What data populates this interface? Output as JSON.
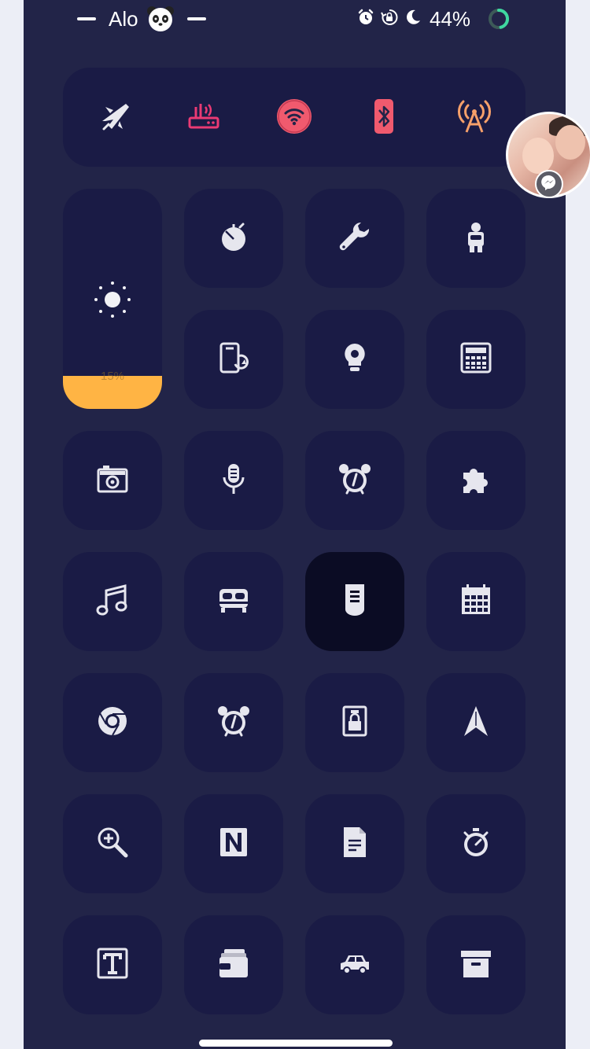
{
  "status_bar": {
    "carrier": "Alo",
    "emoji_icon": "panda-face-icon",
    "icons": [
      "alarm-clock-icon",
      "rotation-lock-icon",
      "moon-icon"
    ],
    "battery_percent": "44%",
    "battery_ring_icon": "battery-ring-icon"
  },
  "connectivity": [
    {
      "name": "airplane-mode",
      "icon": "airplane-icon",
      "color": "#e8e8ee"
    },
    {
      "name": "mobile-hotspot",
      "icon": "router-icon",
      "color": "#ea3a74"
    },
    {
      "name": "wifi",
      "icon": "wifi-icon",
      "color": "#f05a6e"
    },
    {
      "name": "bluetooth",
      "icon": "bluetooth-icon",
      "color": "#f05a6e"
    },
    {
      "name": "cellular-data",
      "icon": "antenna-icon",
      "color": "#f6a06a"
    }
  ],
  "brightness": {
    "icon": "sun-icon",
    "value_label": "15%",
    "level": 0.15,
    "fill_color": "#ffb444"
  },
  "tiles": [
    {
      "name": "timer",
      "icon": "timer-icon"
    },
    {
      "name": "tools",
      "icon": "wrench-icon"
    },
    {
      "name": "accessibility",
      "icon": "astronaut-icon"
    },
    {
      "name": "screen-rotate",
      "icon": "phone-rotate-icon"
    },
    {
      "name": "flashlight",
      "icon": "bulb-icon"
    },
    {
      "name": "calculator",
      "icon": "calculator-icon"
    },
    {
      "name": "camera",
      "icon": "camera-icon"
    },
    {
      "name": "voice-memos",
      "icon": "microphone-icon"
    },
    {
      "name": "alarm",
      "icon": "alarm-clock-icon"
    },
    {
      "name": "shortcuts",
      "icon": "puzzle-icon"
    },
    {
      "name": "music",
      "icon": "music-note-icon"
    },
    {
      "name": "sleep",
      "icon": "bed-icon"
    },
    {
      "name": "remote",
      "icon": "remote-control-icon",
      "active": true
    },
    {
      "name": "calendar",
      "icon": "calendar-icon"
    },
    {
      "name": "chrome",
      "icon": "chrome-icon"
    },
    {
      "name": "alarm-2",
      "icon": "alarm-clock-icon"
    },
    {
      "name": "guided-access",
      "icon": "badge-lock-icon"
    },
    {
      "name": "navigation",
      "icon": "navigation-arrow-icon"
    },
    {
      "name": "magnifier",
      "icon": "zoom-in-icon"
    },
    {
      "name": "notion",
      "icon": "notion-icon"
    },
    {
      "name": "notes",
      "icon": "document-icon"
    },
    {
      "name": "stopwatch",
      "icon": "stopwatch-icon"
    },
    {
      "name": "text-size",
      "icon": "text-size-icon"
    },
    {
      "name": "wallet",
      "icon": "wallet-icon"
    },
    {
      "name": "carplay",
      "icon": "car-icon"
    },
    {
      "name": "archive",
      "icon": "archive-box-icon"
    }
  ],
  "chat_head": {
    "avatar": "avatar",
    "badge_icon": "messenger-icon"
  }
}
